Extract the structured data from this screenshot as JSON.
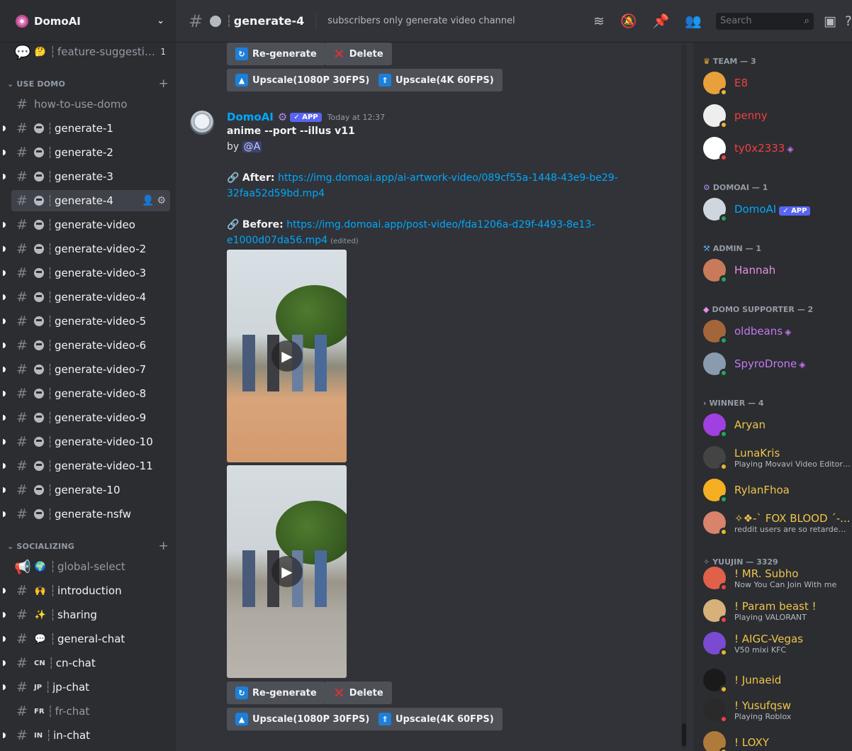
{
  "server": {
    "name": "DomoAI",
    "chevron": "⌄"
  },
  "channels": {
    "feature": {
      "name": "feature-suggestio...",
      "badge": "1"
    },
    "cat_use": "USE DOMO",
    "cat_social": "SOCIALIZING",
    "howto": "how-to-use-domo",
    "gen": [
      "generate-1",
      "generate-2",
      "generate-3"
    ],
    "active": "generate-4",
    "genvid": [
      "generate-video",
      "generate-video-2",
      "generate-video-3",
      "generate-video-4",
      "generate-video-5",
      "generate-video-6",
      "generate-video-7",
      "generate-video-8",
      "generate-video-9",
      "generate-video-10",
      "generate-video-11",
      "generate-10",
      "generate-nsfw"
    ],
    "social": [
      {
        "name": "global-select",
        "emoji": "🌍"
      },
      {
        "name": "introduction",
        "emoji": "🙌"
      },
      {
        "name": "sharing",
        "emoji": "✨"
      },
      {
        "name": "general-chat",
        "emoji": "💬"
      },
      {
        "name": "cn-chat",
        "tag": "CN"
      },
      {
        "name": "jp-chat",
        "tag": "JP"
      },
      {
        "name": "fr-chat",
        "tag": "FR"
      },
      {
        "name": "in-chat",
        "tag": "IN"
      }
    ]
  },
  "header": {
    "channel": "generate-4",
    "topic": "subscribers only generate video channel",
    "search_placeholder": "Search"
  },
  "message": {
    "buttons": {
      "regen": "Re-generate",
      "delete": "Delete",
      "up1080": "Upscale(1080P 30FPS)",
      "up4k": "Upscale(4K 60FPS)"
    },
    "author": "DomoAI",
    "app": "✓ APP",
    "time": "Today at 12:37",
    "command": "anime --port --illus v11",
    "by": "by",
    "mention": "@A",
    "after_label": "After:",
    "after_url1": "https://img.domoai.app/ai-artwork-video/089cf55a-1448-43e9-be29-",
    "after_url2": "32faa52d59bd.mp4",
    "before_label": "Before:",
    "before_url1": "https://img.domoai.app/post-video/fda1206a-d29f-4493-8e13-",
    "before_url2": "e1000d07da56.mp4",
    "edited": "(edited)"
  },
  "members": {
    "groups": {
      "team": "TEAM — 3",
      "domoai": "DOMOAI — 1",
      "admin": "ADMIN — 1",
      "supporter": "DOMO SUPPORTER — 2",
      "winner": "WINNER — 4",
      "yuujin": "YUUJIN — 3329"
    },
    "list": [
      {
        "name": "E8",
        "color": "#f23f43"
      },
      {
        "name": "penny",
        "color": "#f23f43"
      },
      {
        "name": "ty0x2333",
        "color": "#f23f43"
      },
      {
        "name": "DomoAI",
        "color": "#00a8fc",
        "app": "✓ APP"
      },
      {
        "name": "Hannah",
        "color": "#e78fe8"
      },
      {
        "name": "oldbeans",
        "color": "#c478f0"
      },
      {
        "name": "SpyroDrone",
        "color": "#c478f0"
      },
      {
        "name": "Aryan",
        "color": "#f0c44a"
      },
      {
        "name": "LunaKris",
        "color": "#f0c44a",
        "status": "Playing Movavi Video Editor 2..."
      },
      {
        "name": "RylanFhoa",
        "color": "#f0c44a"
      },
      {
        "name": "✧❖-` FOX BLOOD ´-...",
        "color": "#f0c44a",
        "status": "reddit users are so retarded s..."
      },
      {
        "name": "! MR. Subho",
        "color": "#f0c44a",
        "status": "Now You Can Join With me"
      },
      {
        "name": "! Param beast !",
        "color": "#f0c44a",
        "status": "Playing VALORANT"
      },
      {
        "name": "! AIGC-Vegas",
        "color": "#f0c44a",
        "status": "V50 mixi KFC"
      },
      {
        "name": "! Junaeid",
        "color": "#f0c44a"
      },
      {
        "name": "! Yusufqsw",
        "color": "#f0c44a",
        "status": "Playing Roblox"
      },
      {
        "name": "! LOXY",
        "color": "#f0c44a"
      }
    ]
  },
  "colors": {
    "accent": "#5865f2",
    "link": "#00a8fc",
    "online": "#23a55a",
    "idle": "#f0b232",
    "dnd": "#f23f43"
  }
}
